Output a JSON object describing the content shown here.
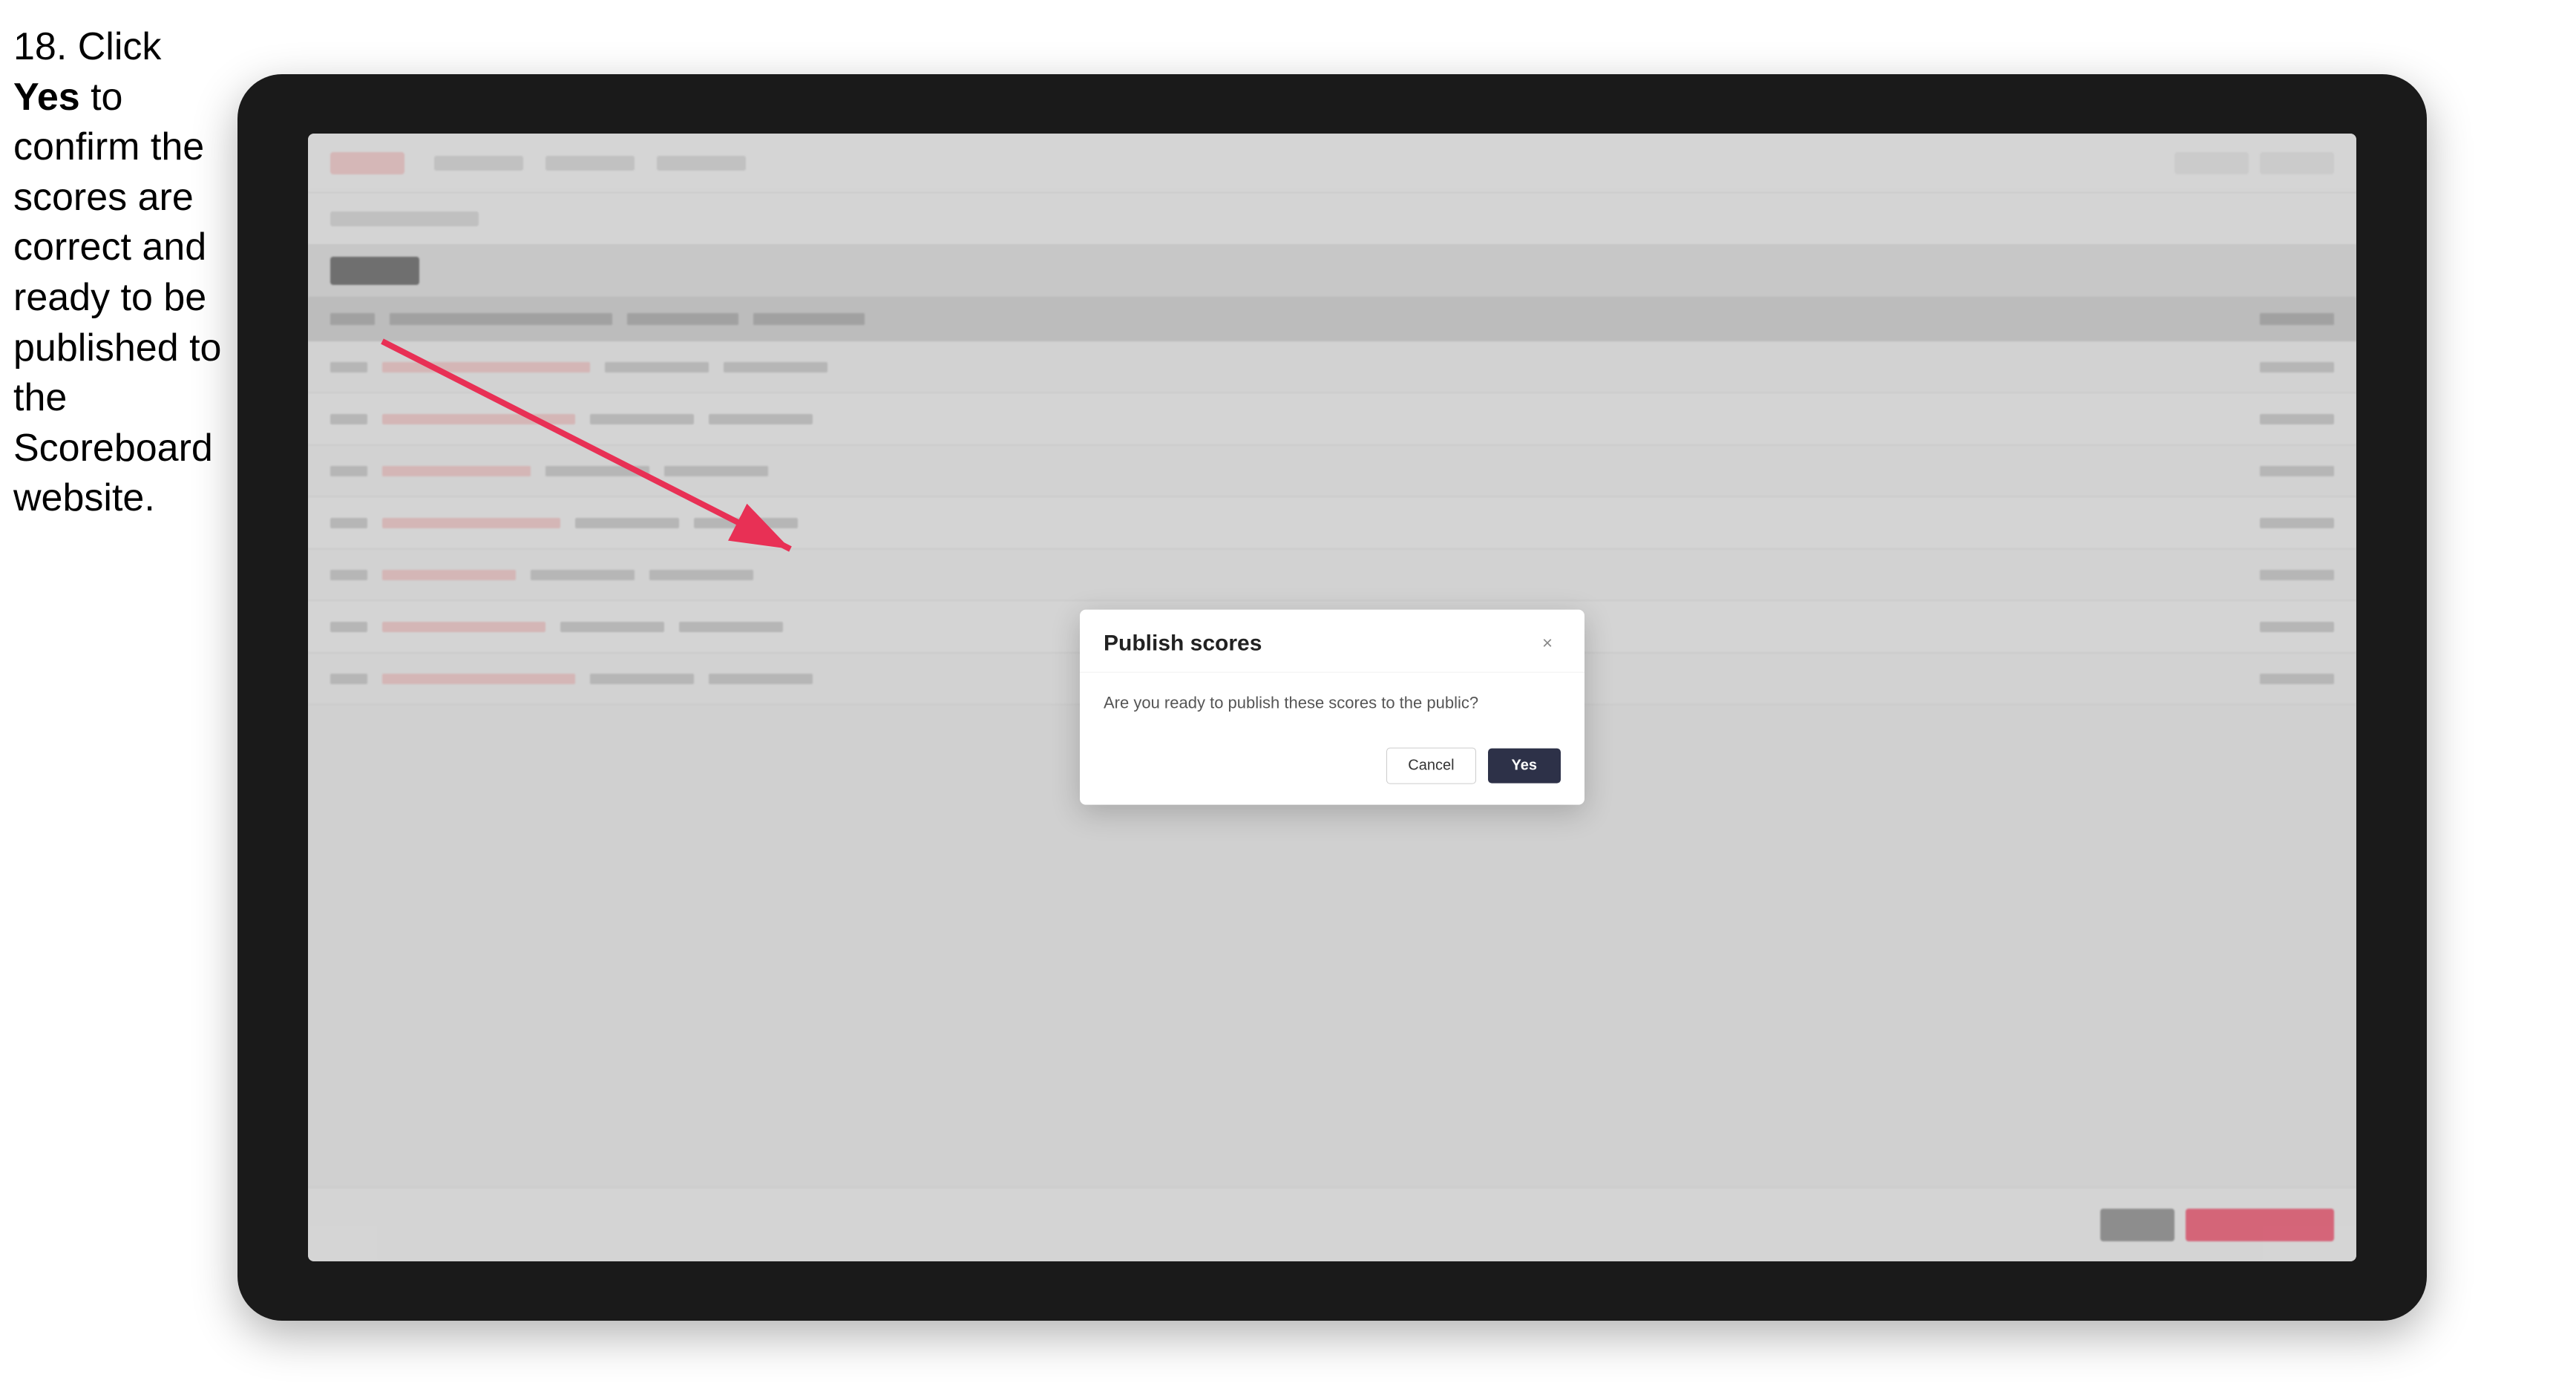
{
  "instruction": {
    "step_number": "18.",
    "text_part1": " Click ",
    "bold_word": "Yes",
    "text_part2": " to confirm the scores are correct and ready to be published to the Scoreboard website."
  },
  "modal": {
    "title": "Publish scores",
    "message": "Are you ready to publish these scores to the public?",
    "close_label": "×",
    "cancel_label": "Cancel",
    "yes_label": "Yes"
  },
  "table": {
    "rows": [
      {
        "cells": [
          "",
          "",
          "",
          "",
          ""
        ]
      },
      {
        "cells": [
          "",
          "",
          "",
          "",
          ""
        ]
      },
      {
        "cells": [
          "",
          "",
          "",
          "",
          ""
        ]
      },
      {
        "cells": [
          "",
          "",
          "",
          "",
          ""
        ]
      },
      {
        "cells": [
          "",
          "",
          "",
          "",
          ""
        ]
      },
      {
        "cells": [
          "",
          "",
          "",
          "",
          ""
        ]
      },
      {
        "cells": [
          "",
          "",
          "",
          "",
          ""
        ]
      }
    ]
  }
}
